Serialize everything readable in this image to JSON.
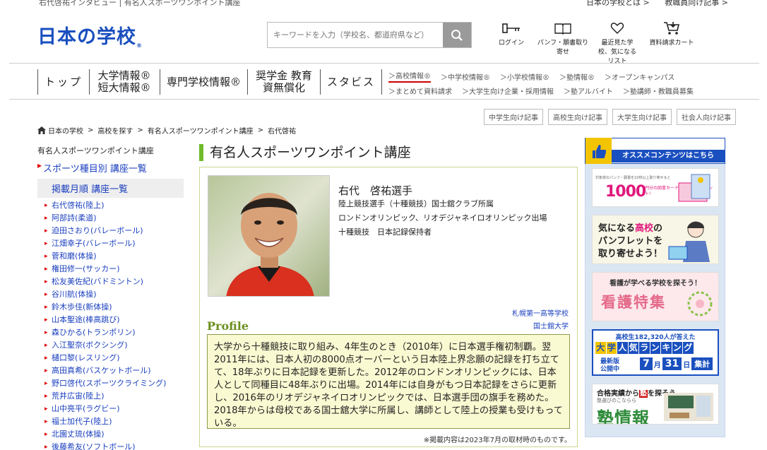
{
  "topstrip": {
    "crumbs": "右代啓祐インタビュー | 有名人スポーツワンポイント講座",
    "links": [
      "日本の学校とは >",
      "教職員向け記事 >"
    ]
  },
  "header": {
    "logo": "日本の学校",
    "logo_mark": "®",
    "search_placeholder": "キーワードを入力（学校名、都道府県など）",
    "icons": [
      {
        "name": "login-icon",
        "label": "ログイン"
      },
      {
        "name": "pamphlet-icon",
        "label": "パンフ・願書取り寄せ"
      },
      {
        "name": "heart-icon",
        "label": "最近見た学校、気になるリスト"
      },
      {
        "name": "cart-icon",
        "label": "資料請求カート"
      }
    ]
  },
  "gnav": {
    "main": [
      "トップ",
      "大学情報® 短大情報®",
      "専門学校情報®",
      "奨学金 教育資無償化",
      "スタビス"
    ],
    "sub_row1": [
      "＞高校情報®",
      "＞中学校情報®",
      "＞小学校情報®",
      "＞塾情報®",
      "＞オープンキャンパス"
    ],
    "sub_row2": [
      "＞まとめて資料請求",
      "＞大学生向け企業・採用情報",
      "＞塾アルバイト",
      "＞塾講師・教職員募集"
    ]
  },
  "audience_buttons": [
    "中学生向け記事",
    "高校生向け記事",
    "大学生向け記事",
    "社会人向け記事"
  ],
  "breadcrumb": [
    "日本の学校",
    "高校を探す",
    "有名人スポーツワンポイント講座",
    "右代啓祐"
  ],
  "sidebar": {
    "title": "有名人スポーツワンポイント講座",
    "link1": "スポーツ種目別 講座一覧",
    "link2": "掲載月順 講座一覧",
    "items": [
      "右代啓祐(陸上)",
      "阿部詩(柔道)",
      "迫田さおり(バレーボール)",
      "江畑幸子(バレーボール)",
      "菅和磨(体操)",
      "権田修一(サッカー)",
      "松友美佐紀(バドミントン)",
      "谷川航(体操)",
      "鈴木歩佳(新体操)",
      "山本聖途(棒高跳び)",
      "森ひかる(トランポリン)",
      "入江聖奈(ボクシング)",
      "樋口黎(レスリング)",
      "高田真希(バスケットボール)",
      "野口啓代(スポーツクライミング)",
      "荒井広宙(陸上)",
      "山中亮平(ラグビー)",
      "福士加代子(陸上)",
      "北園丈琉(体操)",
      "後藤希友(ソフトボール)"
    ]
  },
  "main": {
    "title": "有名人スポーツワンポイント講座",
    "name": "右代　啓祐選手",
    "info": [
      "陸上競技選手（十種競技）国士舘クラブ所属",
      "ロンドンオリンピック、リオデジャネイロオリンピック出場",
      "十種競技　日本記録保持者"
    ],
    "schools": [
      "札幌第一高等学校",
      "国士舘大学"
    ],
    "profile_label": "Profile",
    "profile_text": "大学から十種競技に取り組み、4年生のとき（2010年）に日本選手権初制覇。翌2011年には、日本人初の8000点オーバーという日本陸上界念願の記録を打ち立てて、18年ぶりに日本記録を更新した。2012年のロンドンオリンピックには、日本人として同種目に48年ぶりに出場。2014年には自身がもつ日本記録をさらに更新し、2016年のリオデジャネイロオリンピックでは、日本選手団の旗手を務めた。2018年からは母校である国士舘大学に所属し、講師として陸上の授業も受けもっている。",
    "note": "※掲載内容は2023年7月の取材時のものです。"
  },
  "rightcol": {
    "header": "オススメコンテンツはこちら",
    "b1_small": "対象校のパンフ・願書を10校以上取り寄せると",
    "b1_num": "1000",
    "b1_sub": "円分の図書カードもれなくプレゼント!",
    "b2_line1a": "気になる",
    "b2_line1b": "高校",
    "b2_line1c": "の",
    "b2_line2": "パンフレットを",
    "b2_line3": "取り寄せよう！",
    "b3_t1": "看護が学べる学校を探そう！",
    "b3_t2": "看護特集",
    "b4_t1": "高校生182,320人が答えた",
    "b4_rank": [
      "大",
      "学",
      "人",
      "気",
      "ラ",
      "ン",
      "キ",
      "ン",
      "グ"
    ],
    "b4_pub1": "最新版",
    "b4_pub2": "公開中",
    "b4_month": "7",
    "b4_m": "月",
    "b4_day": "31",
    "b4_d": "日",
    "b4_tail": "集計",
    "b5_t1a": "合格実績から",
    "b5_t1b": "塾",
    "b5_t1c": "を探そう",
    "b5_t2": "塾選びのこならら",
    "b5_t3": "塾情報"
  },
  "colors": {
    "brand": "#1a4fbf",
    "accent": "#6fba2c",
    "pink": "#e0197d"
  }
}
